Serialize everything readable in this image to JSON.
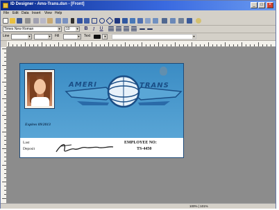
{
  "window": {
    "title": "ID Designer - Ams-Trans.dsn - [Front]",
    "minimize": "_",
    "maximize": "□",
    "close": "×"
  },
  "menu": [
    "File",
    "Edit",
    "Data",
    "Insert",
    "View",
    "Help"
  ],
  "toolbar_format": {
    "font_name": "Times New Roman",
    "font_size": "10",
    "bold": "B",
    "italic": "I",
    "underline": "U"
  },
  "toolbar_line": {
    "line_label": "Line",
    "fill_label": "Fill",
    "text_label": "Text"
  },
  "card": {
    "brand_left": "AMERI",
    "brand_right": "TRANS",
    "expires": "Expires 09/2013",
    "first_name": "Last",
    "last_name": "Deposit",
    "employee_label": "EMPLOYEE NO:",
    "employee_id": "TS-4450",
    "colors": {
      "card_blue": "#3f8ec4",
      "brand_navy": "#1a4e86",
      "strip": "#ffffff"
    }
  },
  "status": {
    "zoom": "100% | 101%"
  },
  "icons": [
    "new-icon",
    "open-icon",
    "save-icon",
    "print-icon",
    "cut-icon",
    "copy-icon",
    "paste-icon",
    "undo-icon",
    "redo-icon",
    "pointer-icon",
    "text-tool-icon",
    "line-tool-icon",
    "rectangle-tool-icon",
    "ellipse-tool-icon",
    "diamond-tool-icon",
    "image-tool-icon",
    "barcode-icon",
    "database-icon",
    "preview-icon",
    "help-icon"
  ]
}
